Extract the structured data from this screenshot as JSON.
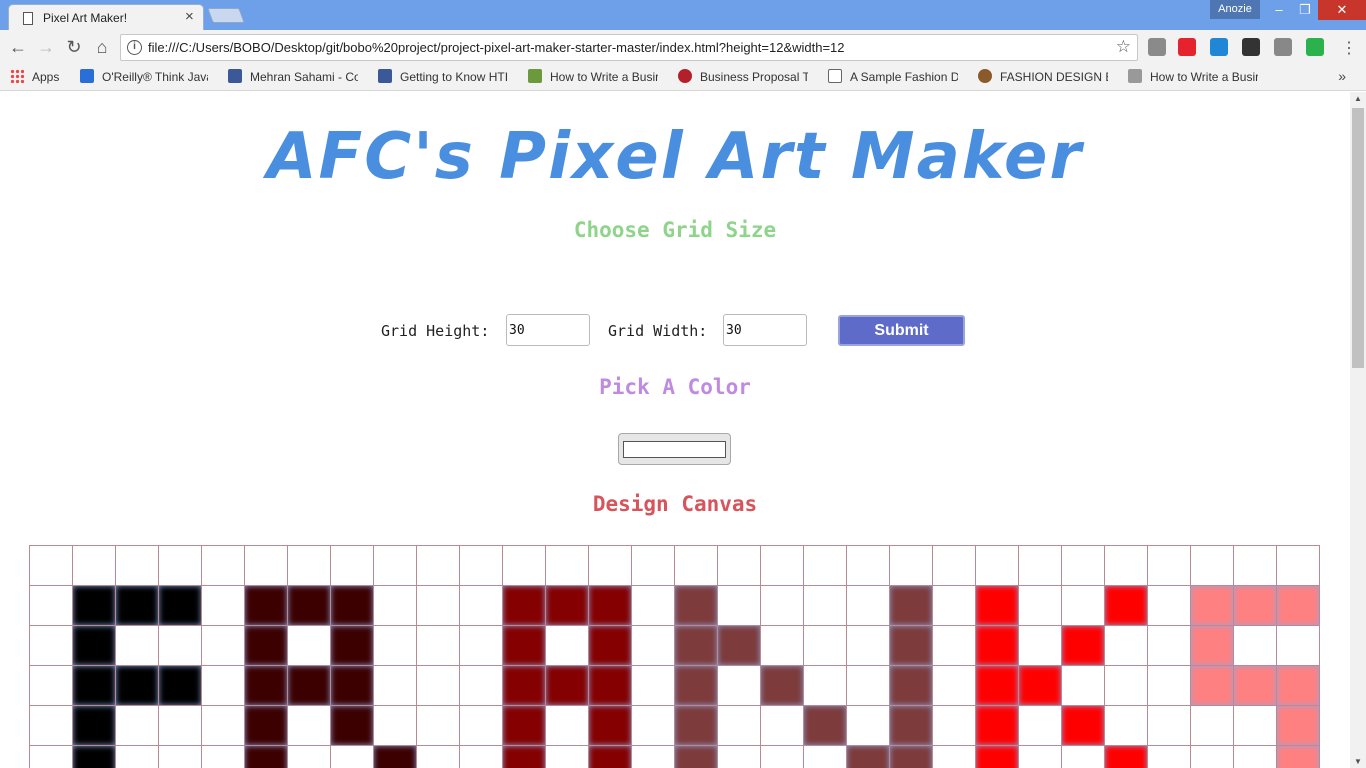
{
  "browser": {
    "tab_title": "Pixel Art Maker!",
    "tab_close": "×",
    "profile_name": "Anozie",
    "url": "file:///C:/Users/BOBO/Desktop/git/bobo%20project/project-pixel-art-maker-starter-master/index.html?height=12&width=12",
    "window_controls": {
      "minimize": "–",
      "maximize": "❐",
      "close": "✕"
    },
    "nav": {
      "back": "←",
      "forward": "→",
      "reload": "↻",
      "home": "⌂"
    },
    "extensions": [
      {
        "name": "gmail-ext-icon",
        "color": "#8a8a8a"
      },
      {
        "name": "opera-ext-icon",
        "color": "#e5232f"
      },
      {
        "name": "skype-ext-icon",
        "color": "#1f87d6"
      },
      {
        "name": "zoom-ext-icon",
        "color": "#333333"
      },
      {
        "name": "settings-ext-icon",
        "color": "#888888"
      },
      {
        "name": "feedly-ext-icon",
        "color": "#2bb24c"
      },
      {
        "name": "menu-icon",
        "color": "#555555"
      }
    ]
  },
  "bookmarks": [
    {
      "label": "Apps",
      "icon": "apps-icon",
      "color": "#e44b3b"
    },
    {
      "label": "O'Reilly® Think Java",
      "icon": "oreilly-icon",
      "color": "#2a6fd8"
    },
    {
      "label": "Mehran Sahami - Co",
      "icon": "facebook-icon",
      "color": "#3b5998"
    },
    {
      "label": "Getting to Know HTI",
      "icon": "facebook-icon",
      "color": "#3b5998"
    },
    {
      "label": "How to Write a Busir",
      "icon": "wikihow-icon",
      "color": "#6b9a3c"
    },
    {
      "label": "Business Proposal Te",
      "icon": "r-icon",
      "color": "#b3202a"
    },
    {
      "label": "A Sample Fashion D",
      "icon": "page-icon",
      "color": "#ffffff"
    },
    {
      "label": "FASHION DESIGN BU",
      "icon": "lion-icon",
      "color": "#8a5a2b"
    },
    {
      "label": "How to Write a Busir",
      "icon": "c-icon",
      "color": "#999999"
    }
  ],
  "bookmarks_more": "»",
  "page": {
    "title": "AFC's Pixel Art Maker",
    "grid_heading": "Choose Grid Size",
    "height_label": "Grid Height:",
    "height_value": "30",
    "width_label": "Grid Width:",
    "width_value": "30",
    "submit_label": "Submit",
    "color_heading": "Pick A Color",
    "selected_color": "#ffffff",
    "canvas_heading": "Design Canvas"
  },
  "canvas": {
    "columns": 30,
    "visible_rows": 6,
    "palette": {
      "K": "#000000",
      "M": "#3d0000",
      "D": "#850000",
      "B": "#7e3b3b",
      "R": "#ff0000",
      "P": "#ff8080"
    },
    "rows": [
      "..............................",
      ".KKK.MMM...DDD.B....B.R..R.PPP",
      ".K...M.M...D.D.BB...B.R.R..P..",
      ".KKK.MMM...DDD.B.B..B.RR...PPP",
      ".K...M.M...D.D.B..B.B.R.R....P",
      ".K...M..M..D.D.B...BB.R..R...P"
    ]
  }
}
